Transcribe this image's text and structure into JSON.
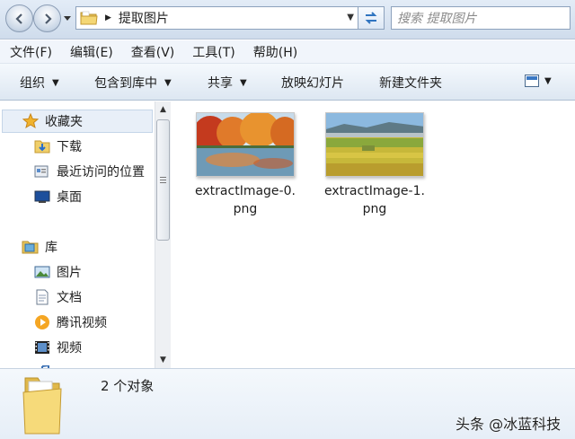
{
  "address": {
    "path": "提取图片"
  },
  "search": {
    "placeholder": "搜索 提取图片"
  },
  "menu": [
    "文件(F)",
    "编辑(E)",
    "查看(V)",
    "工具(T)",
    "帮助(H)"
  ],
  "toolbar": {
    "organize": "组织",
    "include_library": "包含到库中",
    "share": "共享",
    "slideshow": "放映幻灯片",
    "new_folder": "新建文件夹"
  },
  "nav": {
    "favorites": "收藏夹",
    "downloads": "下载",
    "recent": "最近访问的位置",
    "desktop": "桌面",
    "libraries": "库",
    "pictures": "图片",
    "documents": "文档",
    "tencent_video": "腾讯视频",
    "videos": "视频"
  },
  "files": [
    {
      "name_line1": "extractImage-0.",
      "name_line2": "png",
      "icon": "autumn-lake-thumbnail"
    },
    {
      "name_line1": "extractImage-1.",
      "name_line2": "png",
      "icon": "rice-field-thumbnail"
    }
  ],
  "status": {
    "count": "2 个对象"
  },
  "watermark": "头条 @冰蓝科技",
  "colors": {
    "nav_selected": "#e8eff8",
    "toolbar_top": "#f5f9fd",
    "toolbar_bottom": "#dde7f2"
  }
}
